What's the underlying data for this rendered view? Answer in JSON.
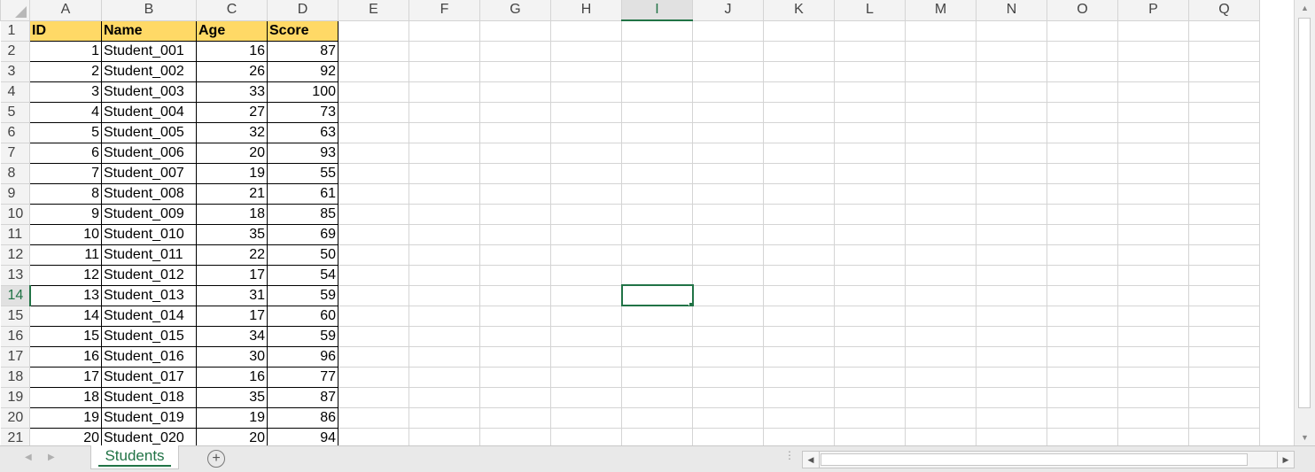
{
  "sheet": {
    "columns": [
      "A",
      "B",
      "C",
      "D",
      "E",
      "F",
      "G",
      "H",
      "I",
      "J",
      "K",
      "L",
      "M",
      "N",
      "O",
      "P",
      "Q"
    ],
    "selected_column": "I",
    "selected_row": 14,
    "header_row": [
      "ID",
      "Name",
      "Age",
      "Score"
    ],
    "rows": [
      [
        1,
        "Student_001",
        16,
        87
      ],
      [
        2,
        "Student_002",
        26,
        92
      ],
      [
        3,
        "Student_003",
        33,
        100
      ],
      [
        4,
        "Student_004",
        27,
        73
      ],
      [
        5,
        "Student_005",
        32,
        63
      ],
      [
        6,
        "Student_006",
        20,
        93
      ],
      [
        7,
        "Student_007",
        19,
        55
      ],
      [
        8,
        "Student_008",
        21,
        61
      ],
      [
        9,
        "Student_009",
        18,
        85
      ],
      [
        10,
        "Student_010",
        35,
        69
      ],
      [
        11,
        "Student_011",
        22,
        50
      ],
      [
        12,
        "Student_012",
        17,
        54
      ],
      [
        13,
        "Student_013",
        31,
        59
      ],
      [
        14,
        "Student_014",
        17,
        60
      ],
      [
        15,
        "Student_015",
        34,
        59
      ],
      [
        16,
        "Student_016",
        30,
        96
      ],
      [
        17,
        "Student_017",
        16,
        77
      ],
      [
        18,
        "Student_018",
        35,
        87
      ],
      [
        19,
        "Student_019",
        19,
        86
      ],
      [
        20,
        "Student_020",
        20,
        94
      ]
    ]
  },
  "tabs": {
    "active": "Students",
    "add_icon": "add-sheet-icon"
  },
  "colors": {
    "header_fill": "#ffd966",
    "accent": "#217346"
  }
}
